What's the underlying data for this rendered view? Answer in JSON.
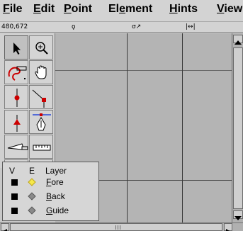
{
  "menubar": {
    "items": [
      {
        "rest": "ile",
        "mnemonic": "F"
      },
      {
        "rest": "dit",
        "mnemonic": "E"
      },
      {
        "rest": "oint",
        "mnemonic": "P"
      },
      {
        "pre": "El",
        "mnemonic": "e",
        "rest": "ment"
      },
      {
        "rest": "ints",
        "mnemonic": "H"
      },
      {
        "rest": "iew",
        "mnemonic": "V"
      }
    ]
  },
  "infobar": {
    "coords": "480,672",
    "point_glyph": "ϙ",
    "tangent_glyph": "σ↗",
    "width_glyph": "|↔|"
  },
  "toolbox": {
    "tools": [
      {
        "name": "pointer-tool-icon",
        "selected": true
      },
      {
        "name": "magnify-tool-icon",
        "selected": false
      },
      {
        "name": "freehand-tool-icon",
        "selected": false
      },
      {
        "name": "scroll-hand-tool-icon",
        "selected": false
      },
      {
        "name": "curve-point-tool-icon",
        "selected": false
      },
      {
        "name": "corner-point-tool-icon",
        "selected": false
      },
      {
        "name": "tangent-point-tool-icon",
        "selected": false
      },
      {
        "name": "pen-tool-icon",
        "selected": false
      },
      {
        "name": "knife-tool-icon",
        "selected": false
      },
      {
        "name": "ruler-tool-icon",
        "selected": false
      },
      {
        "name": "scale-tool-icon",
        "selected": false
      },
      {
        "name": "rotate-tool-icon",
        "selected": false
      }
    ]
  },
  "layers": {
    "col_visible": "V",
    "col_editable": "E",
    "col_layer": "Layer",
    "rows": [
      {
        "mnemonic": "F",
        "rest": "ore",
        "diamond_color": "#f6e84a",
        "active": true
      },
      {
        "mnemonic": "B",
        "rest": "ack",
        "diamond_color": "#8a8a8a",
        "active": false
      },
      {
        "mnemonic": "G",
        "rest": "uide",
        "diamond_color": "#8a8a8a",
        "active": false
      }
    ]
  },
  "colors": {
    "tool_red": "#cc0000",
    "tool_blue": "#2a4ad8",
    "tool_green": "#2a8a2a",
    "canvas": "#b4b4b4"
  }
}
